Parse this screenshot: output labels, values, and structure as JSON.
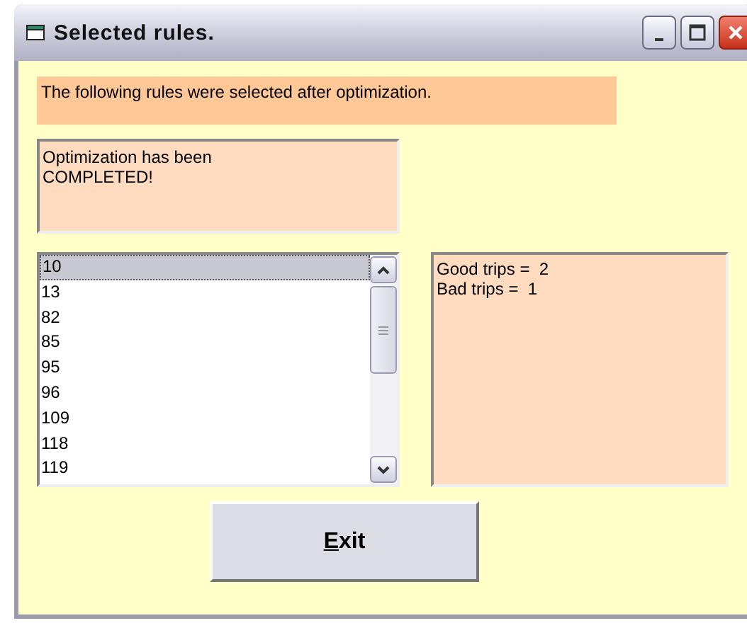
{
  "window": {
    "title": "Selected rules."
  },
  "header_label": "The following rules were selected after optimization.",
  "status_box": {
    "lines": [
      "Optimization has been",
      "COMPLETED!"
    ]
  },
  "rules_list": {
    "items": [
      {
        "label": "10",
        "selected": true
      },
      {
        "label": "13",
        "selected": false
      },
      {
        "label": "82",
        "selected": false
      },
      {
        "label": "85",
        "selected": false
      },
      {
        "label": "95",
        "selected": false
      },
      {
        "label": "96",
        "selected": false
      },
      {
        "label": "109",
        "selected": false
      },
      {
        "label": "118",
        "selected": false
      },
      {
        "label": "119",
        "selected": false
      }
    ]
  },
  "results_box": {
    "lines": [
      "Good trips =  2",
      "Bad trips =  1"
    ]
  },
  "exit_button": {
    "label": "Exit",
    "underline_first": true
  }
}
